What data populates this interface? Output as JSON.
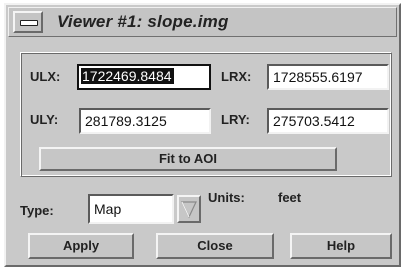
{
  "window": {
    "title": "Viewer #1: slope.img"
  },
  "coords": {
    "ulx_label": "ULX:",
    "ulx_value": "1722469.8484",
    "lrx_label": "LRX:",
    "lrx_value": "1728555.6197",
    "uly_label": "ULY:",
    "uly_value": "281789.3125",
    "lry_label": "LRY:",
    "lry_value": "275703.5412",
    "fit_label": "Fit to AOI"
  },
  "type_row": {
    "type_label": "Type:",
    "type_value": "Map",
    "units_label": "Units:",
    "units_value": "feet"
  },
  "buttons": {
    "apply": "Apply",
    "close": "Close",
    "help": "Help"
  },
  "icons": {
    "window_menu": "window-menu-icon",
    "dropdown": "triangle-down-icon"
  }
}
